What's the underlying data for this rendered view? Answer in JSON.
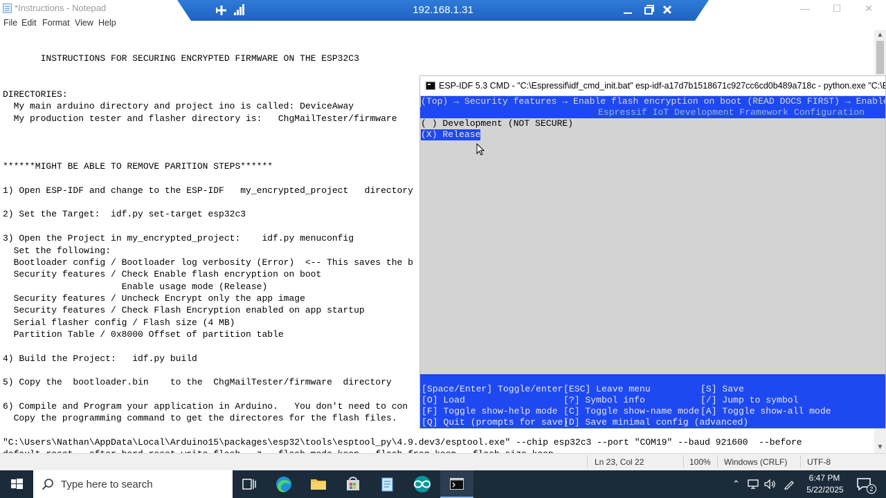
{
  "notepad": {
    "title": "*Instructions - Notepad",
    "menu": [
      "File",
      "Edit",
      "Format",
      "View",
      "Help"
    ],
    "window_controls": {
      "minimize": "—",
      "maximize": "☐",
      "close": "✕"
    },
    "content": "       INSTRUCTIONS FOR SECURING ENCRYPTED FIRMWARE ON THE ESP32C3\n\n\nDIRECTORIES:\n  My main arduino directory and project ino is called: DeviceAway\n  My production tester and flasher directory is:   ChgMailTester/firmware\n\n\n\n******MIGHT BE ABLE TO REMOVE PARITION STEPS******\n\n1) Open ESP-IDF and change to the ESP-IDF   my_encrypted_project   directory\n\n2) Set the Target:  idf.py set-target esp32c3\n\n3) Open the Project in my_encrypted_project:    idf.py menuconfig\n  Set the following:\n  Bootloader config / Bootloader log verbosity (Error)  <-- This saves the b\n  Security features / Check Enable flash encryption on boot\n                      Enable usage mode (Release)\n  Security features / Uncheck Encrypt only the app image\n  Security features / Check Flash Encryption enabled on app startup\n  Serial flasher config / Flash size (4 MB)\n  Partition Table / 0x8000 Offset of partition table\n\n4) Build the Project:   idf.py build\n\n5) Copy the  bootloader.bin    to the  ChgMailTester/firmware  directory\n\n6) Compile and Program your application in Arduino.   You don't need to con\n  Copy the programming command to get the directores for the flash files.\n\n\"C:\\Users\\Nathan\\AppData\\Local\\Arduino15\\packages\\esp32\\tools\\esptool_py\\4.9.dev3/esptool.exe\" --chip esp32c3 --port \"COM19\" --baud 921600  --before\ndefault_reset --after hard_reset write_flash  -z --flash_mode keep --flash_freq keep --flash_size keep",
    "status": {
      "position": "Ln 23, Col 22",
      "zoom": "100%",
      "line_ending": "Windows (CRLF)",
      "encoding": "UTF-8"
    }
  },
  "remote_bar": {
    "host": "192.168.1.31",
    "pin_icon": "pin-icon",
    "signal_icon": "connection-signal-icon",
    "controls": {
      "minimize": "—",
      "restore": "❐",
      "close": "✕"
    }
  },
  "esp_console": {
    "title": "ESP-IDF 5.3 CMD - \"C:\\Espressif\\idf_cmd_init.bat\"  esp-idf-a17d7b1518671c927cc6cd0b489a718c - python.exe  \"C:\\Espres",
    "breadcrumb": "(Top) → Security features → Enable flash encryption on boot (READ DOCS FIRST) → Enable usage",
    "framework_title": "Espressif IoT Development Framework Configuration",
    "options": [
      {
        "label": "( ) Development (NOT SECURE)",
        "selected": false
      },
      {
        "label": "(X) Release",
        "selected": true
      }
    ],
    "help_rows": [
      [
        "[Space/Enter] Toggle/enter",
        "[ESC] Leave menu",
        "[S] Save"
      ],
      [
        "[O] Load",
        "[?] Symbol info",
        "[/] Jump to symbol"
      ],
      [
        "[F] Toggle show-help mode",
        "[C] Toggle show-name mode",
        "[A] Toggle show-all mode"
      ],
      [
        "[Q] Quit (prompts for save)",
        "[D] Save minimal config (advanced)",
        ""
      ]
    ],
    "colors": {
      "bar": "#1e49f0",
      "body": "#d3d3d3"
    }
  },
  "taskbar": {
    "search_placeholder": "Type here to search",
    "time": "6:47 PM",
    "date": "5/22/2025",
    "notification_count": "2",
    "apps": [
      "task-view-icon",
      "edge-icon",
      "file-explorer-icon",
      "store-icon",
      "notepad-icon",
      "arduino-icon",
      "terminal-icon"
    ]
  }
}
